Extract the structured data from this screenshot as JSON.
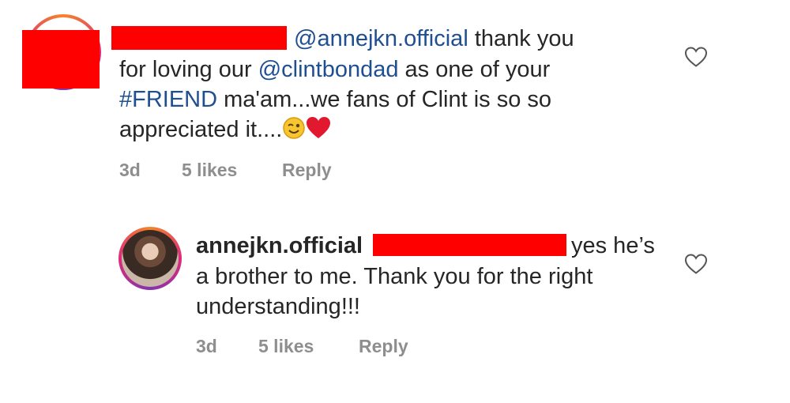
{
  "comment1": {
    "line1_tail": " thank you",
    "mention_anne": "@annejkn.official",
    "line2_pre": "for loving our ",
    "mention_clint": "@clintbondad",
    "line2_post": " as one of your",
    "hashtag": "#FRIEND",
    "line3_post": " ma'am...we fans of Clint is so so",
    "line4": "appreciated it....",
    "age": "3d",
    "likes": "5 likes",
    "reply": "Reply"
  },
  "comment2": {
    "username": "annejkn.official",
    "line1_tail": "yes he’s",
    "line2": "a brother to me. Thank you for the right",
    "line3": "understanding!!!",
    "age": "3d",
    "likes": "5 likes",
    "reply": "Reply"
  },
  "icons": {
    "heart": "heart-outline-icon",
    "wink": "winking-face-emoji",
    "red_heart": "red-heart-emoji"
  }
}
